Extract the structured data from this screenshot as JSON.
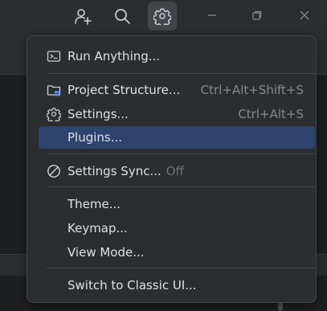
{
  "toolbar": {
    "add_user_icon": "person-add-icon",
    "search_icon": "search-icon",
    "settings_icon": "gear-icon",
    "minimize_icon": "minimize-icon",
    "restore_icon": "restore-icon",
    "close_icon": "close-icon"
  },
  "menu": {
    "run_anything": {
      "label": "Run Anything...",
      "icon": "run-anything-icon"
    },
    "project_structure": {
      "label": "Project Structure...",
      "shortcut": "Ctrl+Alt+Shift+S",
      "icon": "project-structure-icon"
    },
    "settings": {
      "label": "Settings...",
      "shortcut": "Ctrl+Alt+S",
      "icon": "gear-icon"
    },
    "plugins": {
      "label": "Plugins..."
    },
    "settings_sync": {
      "label": "Settings Sync...",
      "state": "Off",
      "icon": "sync-disabled-icon"
    },
    "theme": {
      "label": "Theme..."
    },
    "keymap": {
      "label": "Keymap..."
    },
    "view_mode": {
      "label": "View Mode..."
    },
    "classic_ui": {
      "label": "Switch to Classic UI..."
    }
  },
  "colors": {
    "selection": "#2e436e",
    "menu_bg": "#2b2d30",
    "text": "#dfe1e5",
    "muted": "#868a91"
  }
}
